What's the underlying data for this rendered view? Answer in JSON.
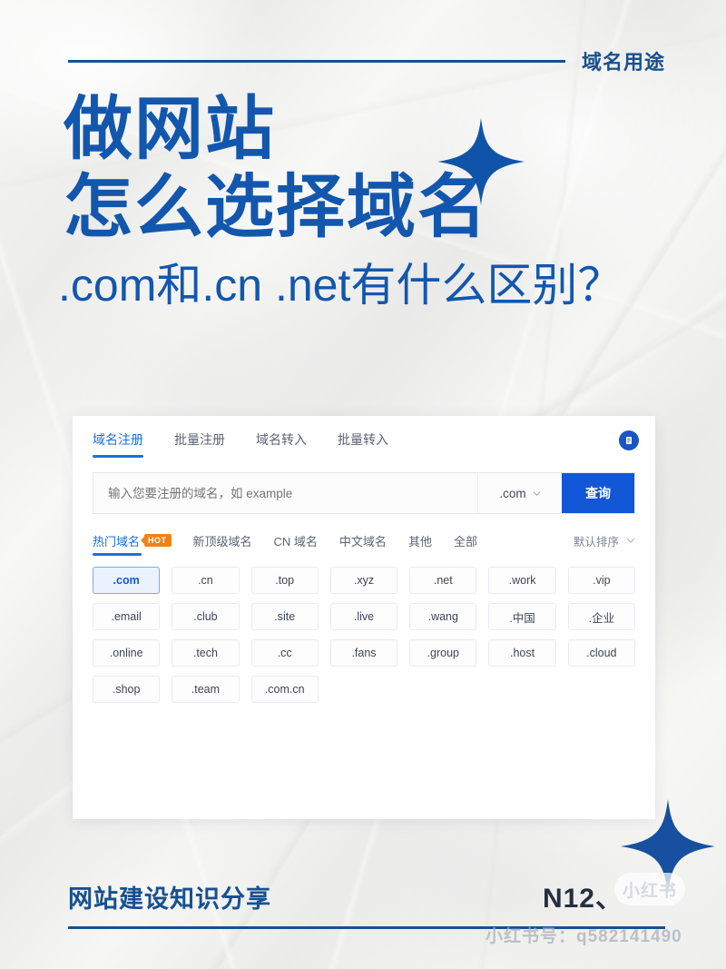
{
  "header": {
    "label": "域名用途"
  },
  "title": {
    "line1": "做网站",
    "line2": "怎么选择域名",
    "subtitle": ".com和.cn .net有什么区别？"
  },
  "panel": {
    "tabs": [
      {
        "label": "域名注册",
        "active": true
      },
      {
        "label": "批量注册",
        "active": false
      },
      {
        "label": "域名转入",
        "active": false
      },
      {
        "label": "批量转入",
        "active": false
      }
    ],
    "badge_icon": "document-icon",
    "search": {
      "placeholder": "输入您要注册的域名，如 example",
      "value": "",
      "tld_selected": ".com",
      "tld_caret_icon": "chevron-down-icon",
      "button_label": "查询"
    },
    "filters": [
      {
        "label": "热门域名",
        "active": true,
        "badge": "HOT"
      },
      {
        "label": "新顶级域名",
        "active": false,
        "badge": ""
      },
      {
        "label": "CN 域名",
        "active": false,
        "badge": ""
      },
      {
        "label": "中文域名",
        "active": false,
        "badge": ""
      },
      {
        "label": "其他",
        "active": false,
        "badge": ""
      },
      {
        "label": "全部",
        "active": false,
        "badge": ""
      }
    ],
    "sort": {
      "label": "默认排序",
      "caret_icon": "chevron-down-icon"
    },
    "chips": [
      {
        "label": ".com",
        "selected": true
      },
      {
        "label": ".cn",
        "selected": false
      },
      {
        "label": ".top",
        "selected": false
      },
      {
        "label": ".xyz",
        "selected": false
      },
      {
        "label": ".net",
        "selected": false
      },
      {
        "label": ".work",
        "selected": false
      },
      {
        "label": ".vip",
        "selected": false
      },
      {
        "label": ".email",
        "selected": false
      },
      {
        "label": ".club",
        "selected": false
      },
      {
        "label": ".site",
        "selected": false
      },
      {
        "label": ".live",
        "selected": false
      },
      {
        "label": ".wang",
        "selected": false
      },
      {
        "label": ".中国",
        "selected": false
      },
      {
        "label": ".企业",
        "selected": false
      },
      {
        "label": ".online",
        "selected": false
      },
      {
        "label": ".tech",
        "selected": false
      },
      {
        "label": ".cc",
        "selected": false
      },
      {
        "label": ".fans",
        "selected": false
      },
      {
        "label": ".group",
        "selected": false
      },
      {
        "label": ".host",
        "selected": false
      },
      {
        "label": ".cloud",
        "selected": false
      },
      {
        "label": ".shop",
        "selected": false
      },
      {
        "label": ".team",
        "selected": false
      },
      {
        "label": ".com.cn",
        "selected": false
      }
    ]
  },
  "footer": {
    "left_label": "网站建设知识分享",
    "right_label": "N12、"
  },
  "watermark": {
    "logo_text": "小红书",
    "id_text": "小红书号：q582141490"
  },
  "colors": {
    "brand_blue": "#1257ad",
    "deep_blue": "#17508f",
    "ui_blue": "#1a6fe0",
    "button_blue": "#1257d6",
    "hot_orange": "#f08218",
    "paper": "#f2f2f1"
  },
  "decor": {
    "sparkle_top": "sparkle-icon",
    "sparkle_bottom": "sparkle-icon"
  }
}
